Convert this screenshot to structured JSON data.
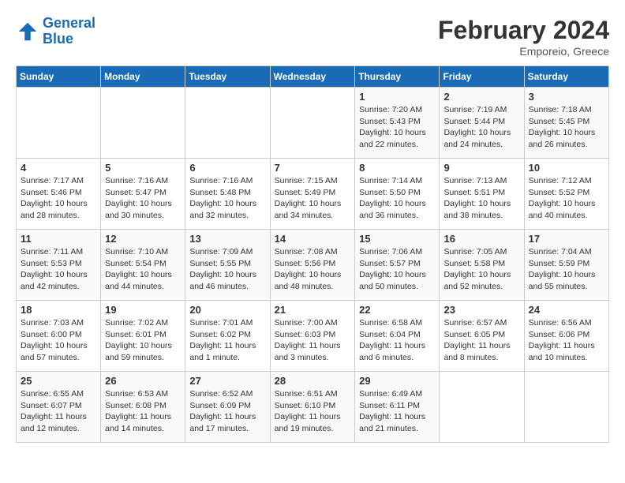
{
  "header": {
    "logo_line1": "General",
    "logo_line2": "Blue",
    "month": "February 2024",
    "location": "Emporeio, Greece"
  },
  "days_of_week": [
    "Sunday",
    "Monday",
    "Tuesday",
    "Wednesday",
    "Thursday",
    "Friday",
    "Saturday"
  ],
  "weeks": [
    [
      {
        "day": "",
        "detail": ""
      },
      {
        "day": "",
        "detail": ""
      },
      {
        "day": "",
        "detail": ""
      },
      {
        "day": "",
        "detail": ""
      },
      {
        "day": "1",
        "detail": "Sunrise: 7:20 AM\nSunset: 5:43 PM\nDaylight: 10 hours\nand 22 minutes."
      },
      {
        "day": "2",
        "detail": "Sunrise: 7:19 AM\nSunset: 5:44 PM\nDaylight: 10 hours\nand 24 minutes."
      },
      {
        "day": "3",
        "detail": "Sunrise: 7:18 AM\nSunset: 5:45 PM\nDaylight: 10 hours\nand 26 minutes."
      }
    ],
    [
      {
        "day": "4",
        "detail": "Sunrise: 7:17 AM\nSunset: 5:46 PM\nDaylight: 10 hours\nand 28 minutes."
      },
      {
        "day": "5",
        "detail": "Sunrise: 7:16 AM\nSunset: 5:47 PM\nDaylight: 10 hours\nand 30 minutes."
      },
      {
        "day": "6",
        "detail": "Sunrise: 7:16 AM\nSunset: 5:48 PM\nDaylight: 10 hours\nand 32 minutes."
      },
      {
        "day": "7",
        "detail": "Sunrise: 7:15 AM\nSunset: 5:49 PM\nDaylight: 10 hours\nand 34 minutes."
      },
      {
        "day": "8",
        "detail": "Sunrise: 7:14 AM\nSunset: 5:50 PM\nDaylight: 10 hours\nand 36 minutes."
      },
      {
        "day": "9",
        "detail": "Sunrise: 7:13 AM\nSunset: 5:51 PM\nDaylight: 10 hours\nand 38 minutes."
      },
      {
        "day": "10",
        "detail": "Sunrise: 7:12 AM\nSunset: 5:52 PM\nDaylight: 10 hours\nand 40 minutes."
      }
    ],
    [
      {
        "day": "11",
        "detail": "Sunrise: 7:11 AM\nSunset: 5:53 PM\nDaylight: 10 hours\nand 42 minutes."
      },
      {
        "day": "12",
        "detail": "Sunrise: 7:10 AM\nSunset: 5:54 PM\nDaylight: 10 hours\nand 44 minutes."
      },
      {
        "day": "13",
        "detail": "Sunrise: 7:09 AM\nSunset: 5:55 PM\nDaylight: 10 hours\nand 46 minutes."
      },
      {
        "day": "14",
        "detail": "Sunrise: 7:08 AM\nSunset: 5:56 PM\nDaylight: 10 hours\nand 48 minutes."
      },
      {
        "day": "15",
        "detail": "Sunrise: 7:06 AM\nSunset: 5:57 PM\nDaylight: 10 hours\nand 50 minutes."
      },
      {
        "day": "16",
        "detail": "Sunrise: 7:05 AM\nSunset: 5:58 PM\nDaylight: 10 hours\nand 52 minutes."
      },
      {
        "day": "17",
        "detail": "Sunrise: 7:04 AM\nSunset: 5:59 PM\nDaylight: 10 hours\nand 55 minutes."
      }
    ],
    [
      {
        "day": "18",
        "detail": "Sunrise: 7:03 AM\nSunset: 6:00 PM\nDaylight: 10 hours\nand 57 minutes."
      },
      {
        "day": "19",
        "detail": "Sunrise: 7:02 AM\nSunset: 6:01 PM\nDaylight: 10 hours\nand 59 minutes."
      },
      {
        "day": "20",
        "detail": "Sunrise: 7:01 AM\nSunset: 6:02 PM\nDaylight: 11 hours\nand 1 minute."
      },
      {
        "day": "21",
        "detail": "Sunrise: 7:00 AM\nSunset: 6:03 PM\nDaylight: 11 hours\nand 3 minutes."
      },
      {
        "day": "22",
        "detail": "Sunrise: 6:58 AM\nSunset: 6:04 PM\nDaylight: 11 hours\nand 6 minutes."
      },
      {
        "day": "23",
        "detail": "Sunrise: 6:57 AM\nSunset: 6:05 PM\nDaylight: 11 hours\nand 8 minutes."
      },
      {
        "day": "24",
        "detail": "Sunrise: 6:56 AM\nSunset: 6:06 PM\nDaylight: 11 hours\nand 10 minutes."
      }
    ],
    [
      {
        "day": "25",
        "detail": "Sunrise: 6:55 AM\nSunset: 6:07 PM\nDaylight: 11 hours\nand 12 minutes."
      },
      {
        "day": "26",
        "detail": "Sunrise: 6:53 AM\nSunset: 6:08 PM\nDaylight: 11 hours\nand 14 minutes."
      },
      {
        "day": "27",
        "detail": "Sunrise: 6:52 AM\nSunset: 6:09 PM\nDaylight: 11 hours\nand 17 minutes."
      },
      {
        "day": "28",
        "detail": "Sunrise: 6:51 AM\nSunset: 6:10 PM\nDaylight: 11 hours\nand 19 minutes."
      },
      {
        "day": "29",
        "detail": "Sunrise: 6:49 AM\nSunset: 6:11 PM\nDaylight: 11 hours\nand 21 minutes."
      },
      {
        "day": "",
        "detail": ""
      },
      {
        "day": "",
        "detail": ""
      }
    ]
  ]
}
